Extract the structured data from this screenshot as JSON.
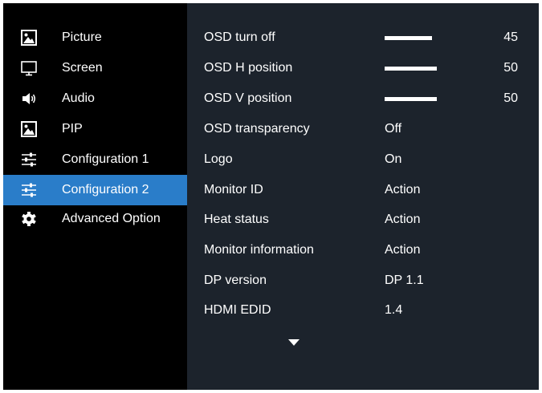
{
  "sidebar": {
    "items": [
      {
        "label": "Picture",
        "icon": "picture-icon"
      },
      {
        "label": "Screen",
        "icon": "screen-icon"
      },
      {
        "label": "Audio",
        "icon": "speaker-icon"
      },
      {
        "label": "PIP",
        "icon": "pip-icon"
      },
      {
        "label": "Configuration 1",
        "icon": "sliders-icon"
      },
      {
        "label": "Configuration 2",
        "icon": "sliders-icon",
        "selected": true
      },
      {
        "label": "Advanced Option",
        "icon": "gear-icon"
      }
    ]
  },
  "settings": {
    "sliders": [
      {
        "label": "OSD turn off",
        "value": "45",
        "level": 0.45
      },
      {
        "label": "OSD H position",
        "value": "50",
        "level": 0.5
      },
      {
        "label": "OSD V position",
        "value": "50",
        "level": 0.5
      }
    ],
    "options": [
      {
        "label": "OSD transparency",
        "value": "Off"
      },
      {
        "label": "Logo",
        "value": "On"
      },
      {
        "label": "Monitor ID",
        "value": "Action"
      },
      {
        "label": "Heat status",
        "value": "Action"
      },
      {
        "label": "Monitor information",
        "value": "Action"
      },
      {
        "label": "DP version",
        "value": "DP 1.1"
      },
      {
        "label": "HDMI EDID",
        "value": "1.4"
      }
    ],
    "scroll_icon": "triangle-down-icon"
  },
  "colors": {
    "sidebar_bg": "#000000",
    "content_bg": "#1c232c",
    "selected_bg": "#2a7dc9",
    "text": "#ffffff"
  }
}
